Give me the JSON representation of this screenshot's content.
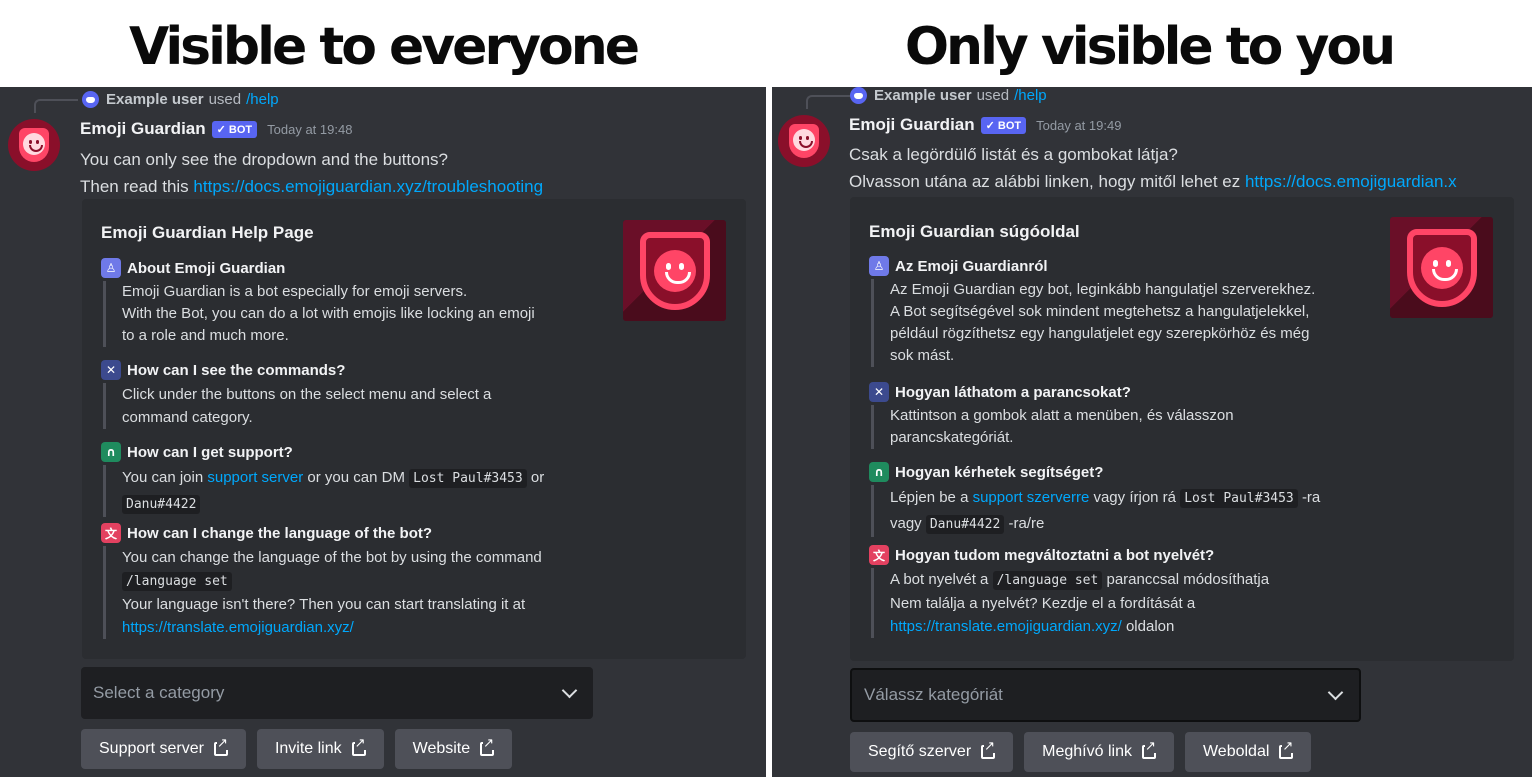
{
  "headings": {
    "left": "Visible to everyone",
    "right": "Only visible to you"
  },
  "left": {
    "reply": {
      "user": "Example user",
      "used": "used",
      "command": "/help"
    },
    "bot_name": "Emoji Guardian",
    "bot_tag": "✓ BOT",
    "timestamp": "Today at 19:48",
    "line1": "You can only see the dropdown and the buttons?",
    "line2_prefix": "Then read this",
    "line2_link": "https://docs.emojiguardian.xyz/troubleshooting",
    "embed": {
      "title": "Emoji Guardian Help Page",
      "fields": [
        {
          "name": "About Emoji Guardian",
          "l1": "Emoji Guardian is a bot especially for emoji servers.",
          "l2": "With the Bot, you can do a lot with emojis like locking an emoji",
          "l3": "to a role and much more."
        },
        {
          "name": "How can I see the commands?",
          "l1": "Click under the buttons on the select menu and select a",
          "l2": "command category."
        },
        {
          "name": "How can I get support?",
          "t1": "You can join",
          "link": "support server",
          "t2": "or you can DM",
          "code1": "Lost Paul#3453",
          "t3": "or",
          "code2": "Danu#4422"
        },
        {
          "name": "How can I change the language of the bot?",
          "l1": "You can change the language of the bot by using the command",
          "code": "/language set",
          "l3": "Your language isn't there? Then you can start translating it at",
          "link": "https://translate.emojiguardian.xyz/"
        }
      ]
    },
    "select_placeholder": "Select a category",
    "buttons": [
      "Support server",
      "Invite link",
      "Website"
    ]
  },
  "right": {
    "reply": {
      "user": "Example user",
      "used": "used",
      "command": "/help"
    },
    "bot_name": "Emoji Guardian",
    "bot_tag": "✓ BOT",
    "timestamp": "Today at 19:49",
    "line1": "Csak a legördülő listát és a gombokat látja?",
    "line2_prefix": "Olvasson utána az alábbi linken, hogy mitől lehet ez",
    "line2_link": "https://docs.emojiguardian.x",
    "embed": {
      "title": "Emoji Guardian súgóoldal",
      "fields": [
        {
          "name": "Az Emoji Guardianról",
          "l1": "Az Emoji Guardian egy bot, leginkább hangulatjel szerverekhez.",
          "l2": "A Bot segítségével sok mindent megtehetsz a hangulatjelekkel,",
          "l3": "például rögzíthetsz egy hangulatjelet egy szerepkörhöz és még",
          "l4": "sok mást."
        },
        {
          "name": "Hogyan láthatom a parancsokat?",
          "l1": "Kattintson a gombok alatt a menüben, és válasszon",
          "l2": "parancskategóriát."
        },
        {
          "name": "Hogyan kérhetek segítséget?",
          "t1": "Lépjen be a",
          "link": "support szerverre",
          "t2": "vagy írjon rá",
          "code1": "Lost Paul#3453",
          "t3": "-ra",
          "t4": "vagy",
          "code2": "Danu#4422",
          "t5": "-ra/re"
        },
        {
          "name": "Hogyan tudom megváltoztatni a bot nyelvét?",
          "t1": "A bot nyelvét a",
          "code": "/language set",
          "t2": "paranccsal módosíthatja",
          "l2": "Nem találja a nyelvét? Kezdje el a fordítását a",
          "link": "https://translate.emojiguardian.xyz/",
          "t3": "oldalon"
        }
      ]
    },
    "select_placeholder": "Válassz kategóriát",
    "buttons": [
      "Segítő szerver",
      "Meghívó link",
      "Weboldal"
    ]
  },
  "icons": {
    "field1": "shield-badge-icon",
    "field2": "tools-icon",
    "field3": "headset-icon",
    "field4": "translate-icon"
  }
}
